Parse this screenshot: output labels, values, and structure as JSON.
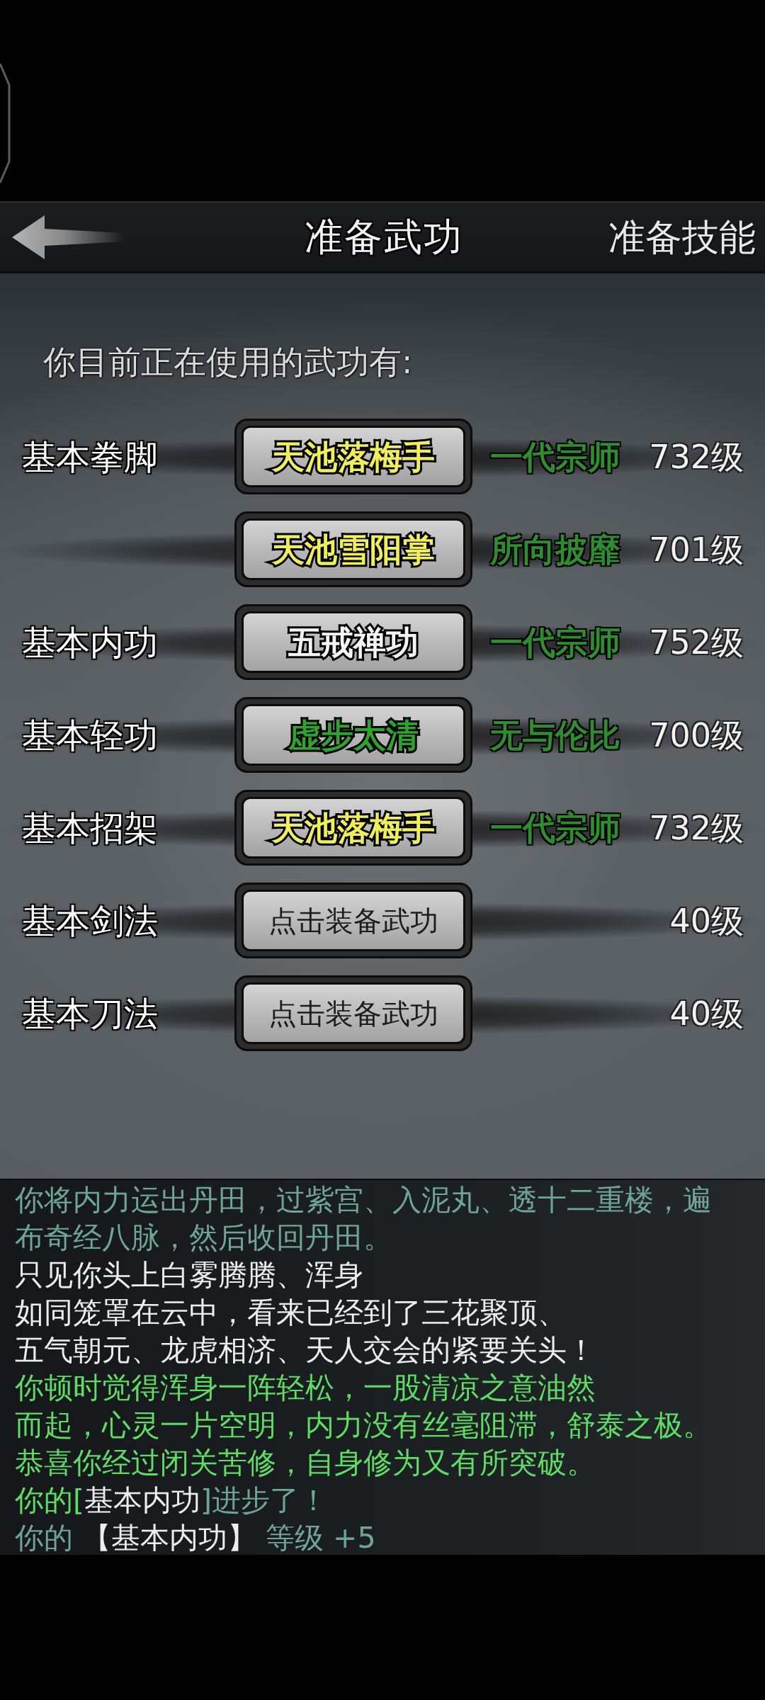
{
  "header": {
    "title": "准备武功",
    "action": "准备技能"
  },
  "intro": "你目前正在使用的武功有:",
  "slots": [
    {
      "category": "基本拳脚",
      "kind": "equipped",
      "skill": "天池落梅手",
      "color": "#f0ee5a",
      "rank": "一代宗师",
      "grade": "732级"
    },
    {
      "kind": "equipped",
      "skill": "天池雪阳掌",
      "color": "#f0ee5a",
      "rank": "所向披靡",
      "grade": "701级"
    },
    {
      "category": "基本内功",
      "kind": "equipped",
      "skill": "五戒禅功",
      "color": "#f4f4f4",
      "rank": "一代宗师",
      "grade": "752级"
    },
    {
      "category": "基本轻功",
      "kind": "equipped",
      "skill": "虚步太清",
      "color": "#2ea42e",
      "rank": "无与伦比",
      "grade": "700级"
    },
    {
      "category": "基本招架",
      "kind": "equipped",
      "skill": "天池落梅手",
      "color": "#f0ee5a",
      "rank": "一代宗师",
      "grade": "732级"
    },
    {
      "category": "基本剑法",
      "kind": "empty",
      "skill": "点击装备武功",
      "grade": "40级"
    },
    {
      "category": "基本刀法",
      "kind": "empty",
      "skill": "点击装备武功",
      "grade": "40级"
    }
  ],
  "log": [
    {
      "segments": [
        {
          "kind": "system",
          "text": "你将内力运出丹田，过紫宫、入泥丸、透十二重楼，遍布奇经八脉，然后收回丹田。"
        }
      ]
    },
    {
      "segments": [
        {
          "kind": "narration",
          "text": "只见你头上白雾腾腾、浑身"
        }
      ]
    },
    {
      "segments": [
        {
          "kind": "narration",
          "text": "如同笼罩在云中，看来已经到了三花聚顶、"
        }
      ]
    },
    {
      "segments": [
        {
          "kind": "narration",
          "text": "五气朝元、龙虎相济、天人交会的紧要关头！"
        }
      ]
    },
    {
      "segments": [
        {
          "kind": "success",
          "text": "你顿时觉得浑身一阵轻松，一股清凉之意油然"
        }
      ]
    },
    {
      "segments": [
        {
          "kind": "success",
          "text": "而起，心灵一片空明，内力没有丝毫阻滞，舒泰之极。"
        }
      ]
    },
    {
      "segments": [
        {
          "kind": "success",
          "text": "恭喜你经过闭关苦修，自身修为又有所突破。"
        }
      ]
    },
    {
      "segments": [
        {
          "kind": "success",
          "text": "你的["
        },
        {
          "kind": "narration",
          "text": "基本内功"
        },
        {
          "kind": "system",
          "text": "]进步了！"
        }
      ]
    },
    {
      "segments": [
        {
          "kind": "system",
          "text": "你的 "
        },
        {
          "kind": "narration",
          "text": "【基本内功】"
        },
        {
          "kind": "system",
          "text": " 等级 +5"
        }
      ]
    }
  ]
}
